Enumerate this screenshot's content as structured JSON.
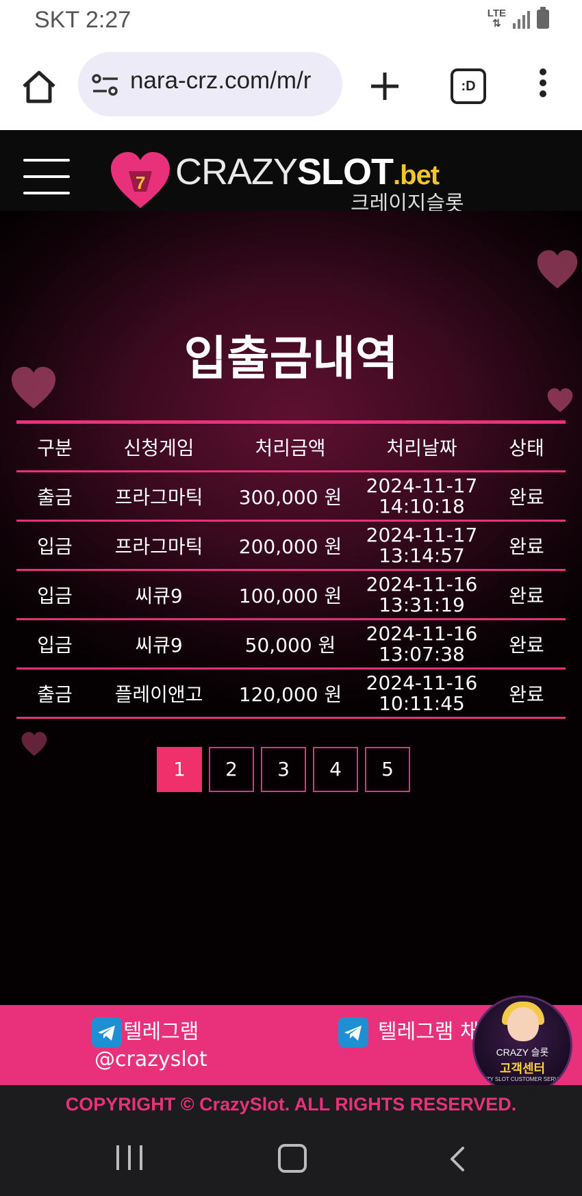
{
  "status_bar": {
    "carrier_time": "SKT 2:27",
    "network": "LTE"
  },
  "browser": {
    "url": "nara-crz.com/m/r",
    "tab_label": ":D"
  },
  "site": {
    "logo_word1": "CRAZY",
    "logo_word2": "SLOT",
    "logo_word3": ".bet",
    "logo_sub": "크레이지슬롯"
  },
  "page": {
    "title": "입출금내역"
  },
  "table": {
    "headers": [
      "구분",
      "신청게임",
      "처리금액",
      "처리날짜",
      "상태"
    ],
    "rows": [
      {
        "type": "출금",
        "game": "프라그마틱",
        "amount": "300,000 원",
        "date": "2024-11-17",
        "time": "14:10:18",
        "status": "완료"
      },
      {
        "type": "입금",
        "game": "프라그마틱",
        "amount": "200,000 원",
        "date": "2024-11-17",
        "time": "13:14:57",
        "status": "완료"
      },
      {
        "type": "입금",
        "game": "씨큐9",
        "amount": "100,000 원",
        "date": "2024-11-16",
        "time": "13:31:19",
        "status": "완료"
      },
      {
        "type": "입금",
        "game": "씨큐9",
        "amount": "50,000 원",
        "date": "2024-11-16",
        "time": "13:07:38",
        "status": "완료"
      },
      {
        "type": "출금",
        "game": "플레이앤고",
        "amount": "120,000 원",
        "date": "2024-11-16",
        "time": "10:11:45",
        "status": "완료"
      }
    ]
  },
  "pagination": {
    "pages": [
      "1",
      "2",
      "3",
      "4",
      "5"
    ],
    "current": "1"
  },
  "footer": {
    "telegram1_label": "텔레그램",
    "telegram1_handle": "@crazyslot",
    "telegram2_label": "텔레그램 채",
    "cs_brand": "CRAZY 슬롯",
    "cs_title": "고객센터",
    "cs_sub": "ZY SLOT CUSTOMER SERV",
    "copyright": "COPYRIGHT © CrazySlot. ALL RIGHTS RESERVED."
  },
  "colors": {
    "accent": "#e8317a",
    "logo_bet": "#f2c62a",
    "telegram": "#1f8fd4"
  }
}
